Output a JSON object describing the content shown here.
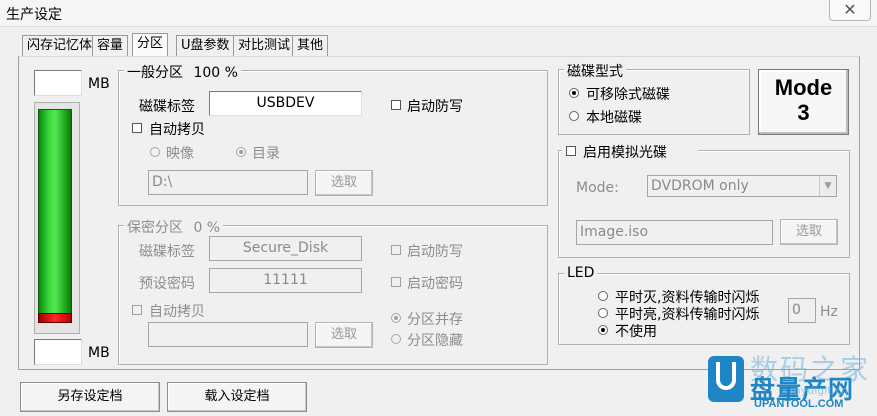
{
  "window": {
    "title": "生产设定",
    "close_glyph": "✕"
  },
  "tabs": [
    {
      "label": "闪存记忆体"
    },
    {
      "label": "容量"
    },
    {
      "label": "分区",
      "active": true
    },
    {
      "label": "U盘参数"
    },
    {
      "label": "对比测试"
    },
    {
      "label": "其他"
    }
  ],
  "capacity": {
    "top_value": "",
    "top_unit": "MB",
    "bottom_value": "",
    "bottom_unit": "MB",
    "fill_ratio": 1.0
  },
  "general_partition": {
    "title": "一般分区",
    "percent": "100 %",
    "disk_label_caption": "磁碟标签",
    "disk_label_value": "USBDEV",
    "write_protect_label": "启动防写",
    "auto_copy_label": "自动拷贝",
    "image_label": "映像",
    "directory_label": "目录",
    "path_value": "D:\\",
    "select_button": "选取"
  },
  "secure_partition": {
    "title": "保密分区",
    "percent": "0 %",
    "disk_label_caption": "磁碟标签",
    "disk_label_value": "Secure_Disk",
    "write_protect_label": "启动防写",
    "password_caption": "预设密码",
    "password_value": "11111",
    "enable_password_label": "启动密码",
    "auto_copy_label": "自动拷贝",
    "path_value": "",
    "select_button": "选取",
    "coexist_label": "分区并存",
    "hide_label": "分区隐藏"
  },
  "disk_type": {
    "title": "磁碟型式",
    "removable_label": "可移除式磁碟",
    "local_label": "本地磁碟"
  },
  "mode_badge": {
    "line1": "Mode",
    "line2": "3"
  },
  "cdrom": {
    "enable_label": "启用模拟光碟",
    "mode_caption": "Mode:",
    "mode_value": "DVDROM only",
    "image_value": "Image.iso",
    "select_button": "选取",
    "arrow_glyph": "▼"
  },
  "led": {
    "title": "LED",
    "option1": "平时灭,资料传输时闪烁",
    "option2": "平时亮,资料传输时闪烁",
    "option3": "不使用",
    "hz_value": "0",
    "hz_unit": "Hz"
  },
  "footer": {
    "save_button": "另存设定档",
    "load_button": "载入设定档"
  },
  "watermark": {
    "big_text": "数码之家",
    "brand_text": "盘量产网",
    "url_text": "UPANTOOL.COM",
    "domain_text": "mydigit.cn"
  },
  "colors": {
    "gauge_green": "#39d439",
    "gauge_red": "#ff2a2a",
    "watermark_blue": "#1f86c6"
  }
}
